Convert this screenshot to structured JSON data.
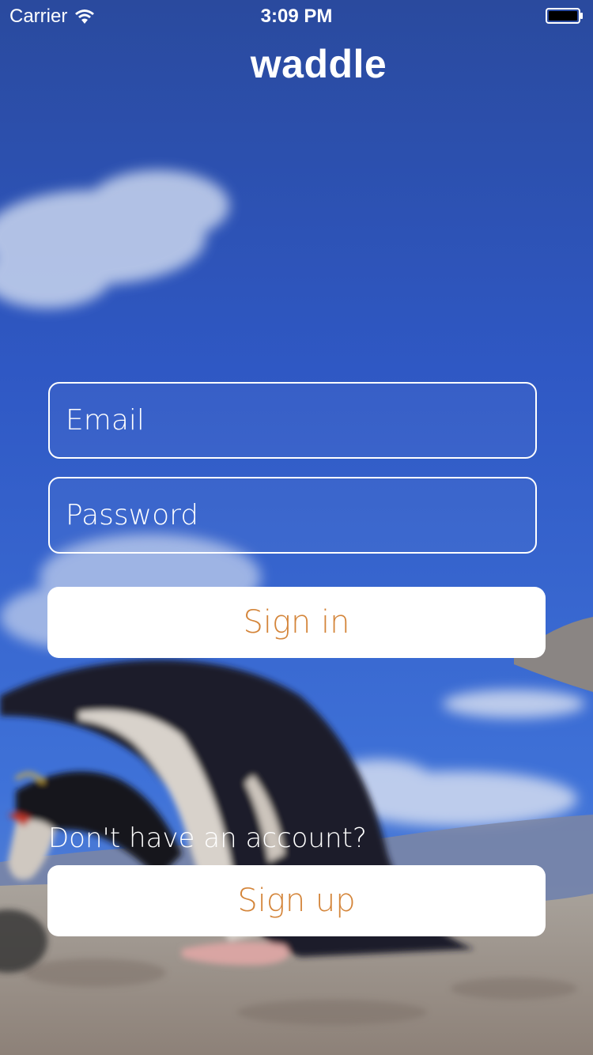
{
  "status_bar": {
    "carrier": "Carrier",
    "time": "3:09 PM"
  },
  "app": {
    "title": "waddle"
  },
  "login_form": {
    "email_placeholder": "Email",
    "password_placeholder": "Password",
    "sign_in_label": "Sign in"
  },
  "signup": {
    "prompt": "Don't have an account?",
    "sign_up_label": "Sign up"
  },
  "icons": {
    "wifi": "wifi-icon",
    "battery": "battery-icon"
  },
  "colors": {
    "button_text": "#d4853a",
    "button_bg": "#ffffff",
    "sky": "#2f55b8"
  }
}
